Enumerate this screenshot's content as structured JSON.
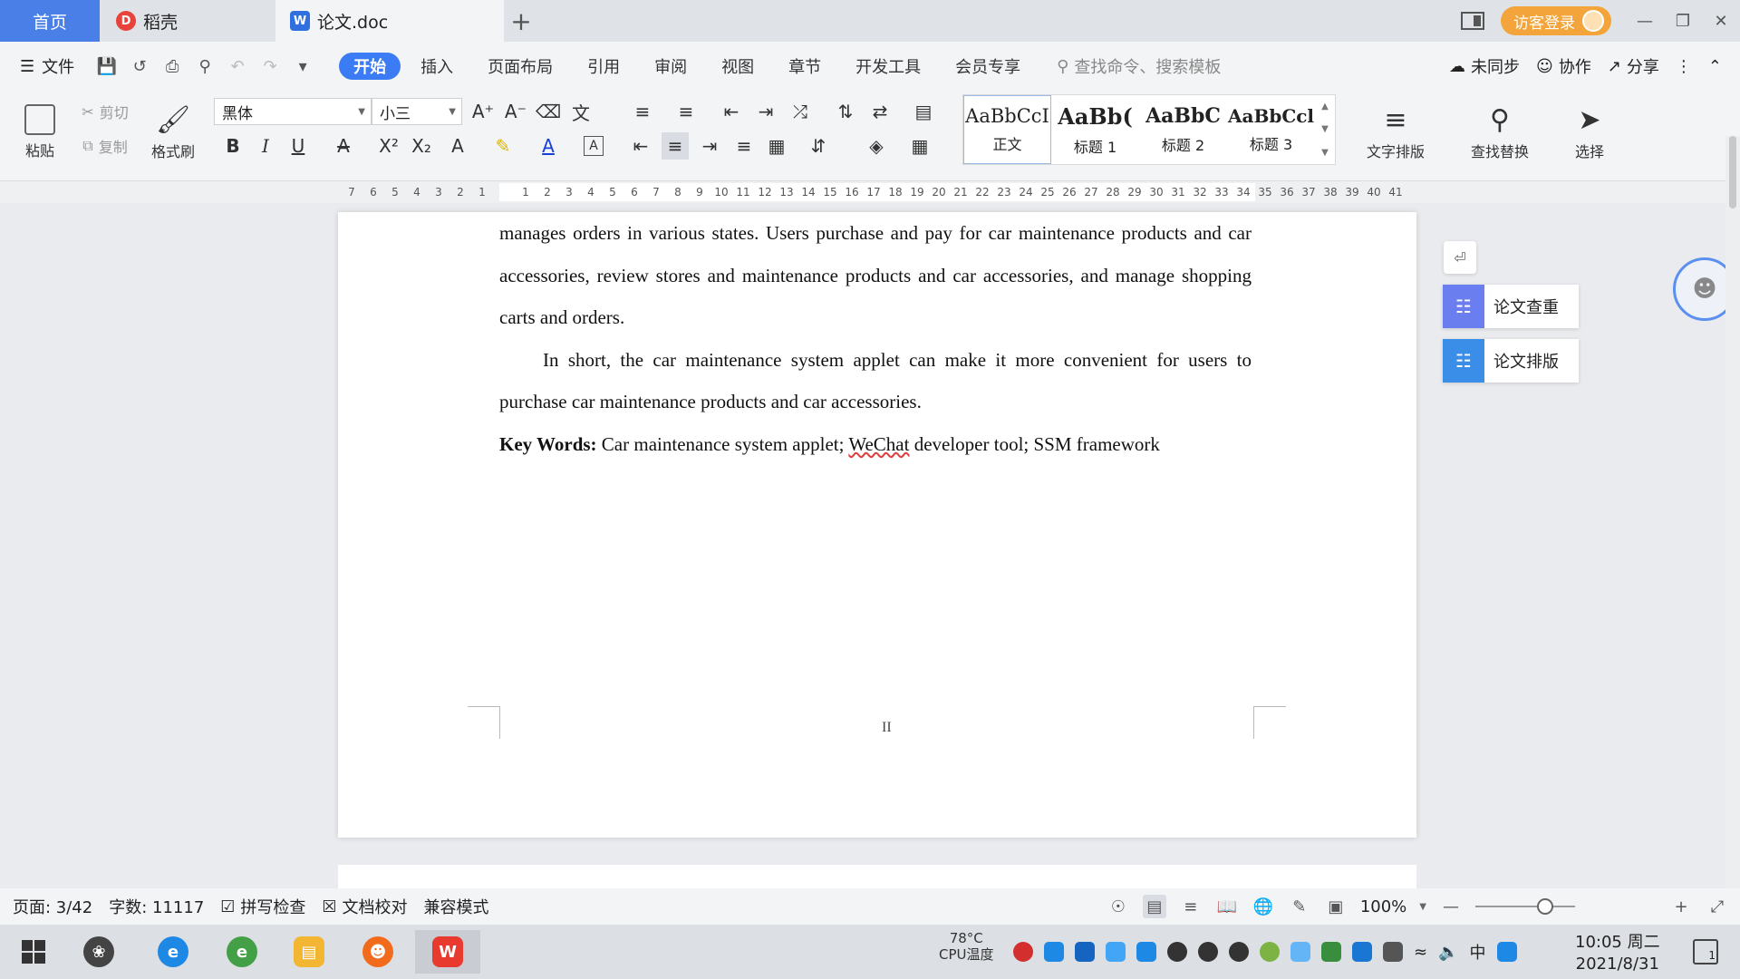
{
  "titlebar": {
    "tab_home": "首页",
    "tab_daoke": "稻壳",
    "tab_doc": "论文.doc",
    "login": "访客登录"
  },
  "menu": {
    "file": "文件",
    "tabs": [
      "开始",
      "插入",
      "页面布局",
      "引用",
      "审阅",
      "视图",
      "章节",
      "开发工具",
      "会员专享"
    ],
    "search_placeholder": "查找命令、搜索模板",
    "unsynced": "未同步",
    "collab": "协作",
    "share": "分享"
  },
  "ribbon": {
    "paste": "粘贴",
    "cut": "剪切",
    "copy": "复制",
    "format_painter": "格式刷",
    "font_name": "黑体",
    "font_size": "小三",
    "styles": [
      {
        "sample": "AaBbCcI",
        "name": "正文"
      },
      {
        "sample": "AaBb(",
        "name": "标题 1"
      },
      {
        "sample": "AaBbC",
        "name": "标题 2"
      },
      {
        "sample": "AaBbCcl",
        "name": "标题 3"
      }
    ],
    "text_layout": "文字排版",
    "find_replace": "查找替换",
    "select": "选择"
  },
  "ruler": {
    "ticks": [
      "7",
      "6",
      "5",
      "4",
      "3",
      "2",
      "1",
      "",
      "1",
      "2",
      "3",
      "4",
      "5",
      "6",
      "7",
      "8",
      "9",
      "10",
      "11",
      "12",
      "13",
      "14",
      "15",
      "16",
      "17",
      "18",
      "19",
      "20",
      "21",
      "22",
      "23",
      "24",
      "25",
      "26",
      "27",
      "28",
      "29",
      "30",
      "31",
      "32",
      "33",
      "34",
      "35",
      "36",
      "37",
      "38",
      "39",
      "40",
      "41"
    ]
  },
  "document": {
    "para1": "manages orders in various states. Users purchase and pay for car maintenance products and car accessories, review stores and maintenance products and car accessories, and manage shopping carts and orders.",
    "para2": "In short, the car maintenance system applet can make it more convenient for users to purchase car maintenance products and car accessories.",
    "keywords_label": "Key Words:",
    "keywords_pre": " Car maintenance system applet; ",
    "keywords_squiggle": "WeChat",
    "keywords_post": " developer tool; SSM framework",
    "page_number": "II"
  },
  "side_panel": {
    "check": "论文查重",
    "layout": "论文排版"
  },
  "statusbar": {
    "page": "页面: 3/42",
    "words": "字数: 11117",
    "spellcheck": "拼写检查",
    "proofread": "文档校对",
    "compat": "兼容模式",
    "zoom": "100%",
    "zoom_level": 0.7
  },
  "taskbar": {
    "cpu_temp": "78°C",
    "cpu_label": "CPU温度",
    "ime": "中",
    "time": "10:05 周二",
    "date": "2021/8/31",
    "notif_count": "1"
  },
  "colors": {
    "accent": "#3b7cf4",
    "home_tab": "#4a7fe8",
    "login": "#f3a43a",
    "wps_red": "#e83a2e"
  }
}
